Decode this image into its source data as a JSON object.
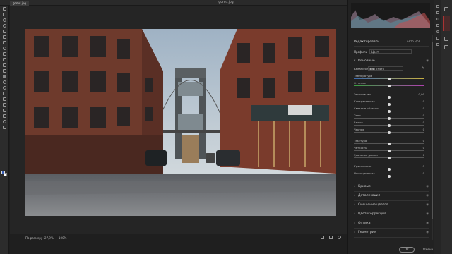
{
  "window": {
    "doc_tab": "gomd.jpg",
    "file_title": "gomd.jpg",
    "close_glyph": "×"
  },
  "toolbar": {
    "icons": [
      "move-icon",
      "marquee-icon",
      "lasso-icon",
      "quick-select-icon",
      "crop-icon",
      "frame-icon",
      "eyedropper-icon",
      "healing-icon",
      "brush-icon",
      "clone-stamp-icon",
      "history-brush-icon",
      "eraser-icon",
      "gradient-icon",
      "blur-icon",
      "dodge-icon",
      "pen-icon",
      "type-icon",
      "path-select-icon",
      "shape-icon",
      "hand-icon",
      "zoom-icon",
      "more-icon"
    ]
  },
  "status": {
    "zoom_fit": "По размеру (27,9%)",
    "zoom_100": "100%"
  },
  "panel": {
    "title": "Редактировать",
    "top_icons": "Авто  B/Ч",
    "profile_label": "Профиль",
    "profile_value": "Цвет",
    "basic": {
      "label": "Основные"
    },
    "wb": {
      "label": "Баланс белого",
      "value": "Как снято"
    },
    "sliders": [
      {
        "label": "Температура",
        "value": "",
        "pos": 0.5
      },
      {
        "label": "Оттенок",
        "value": "",
        "pos": 0.5
      },
      {
        "label": "Экспозиция",
        "value": "0,00",
        "pos": 0.5
      },
      {
        "label": "Контрастность",
        "value": "0",
        "pos": 0.5
      },
      {
        "label": "Светлые области",
        "value": "0",
        "pos": 0.5
      },
      {
        "label": "Тени",
        "value": "0",
        "pos": 0.5
      },
      {
        "label": "Белые",
        "value": "0",
        "pos": 0.5
      },
      {
        "label": "Черные",
        "value": "0",
        "pos": 0.5
      },
      {
        "label": "Текстура",
        "value": "0",
        "pos": 0.5
      },
      {
        "label": "Четкость",
        "value": "0",
        "pos": 0.5
      },
      {
        "label": "Удаление дымки",
        "value": "0",
        "pos": 0.5
      },
      {
        "label": "Красочность",
        "value": "0",
        "pos": 0.5
      },
      {
        "label": "Насыщенность",
        "value": "0",
        "pos": 0.5
      }
    ],
    "sections": [
      "Кривые",
      "Детализация",
      "Смешение цветов",
      "Цветокоррекция",
      "Оптика",
      "Геометрия"
    ]
  },
  "buttons": {
    "ok": "OK",
    "cancel": "Отмена"
  },
  "colors": {
    "foreground": "#3a5fb6",
    "background": "#ffffff",
    "accent_red": "#a33333"
  }
}
